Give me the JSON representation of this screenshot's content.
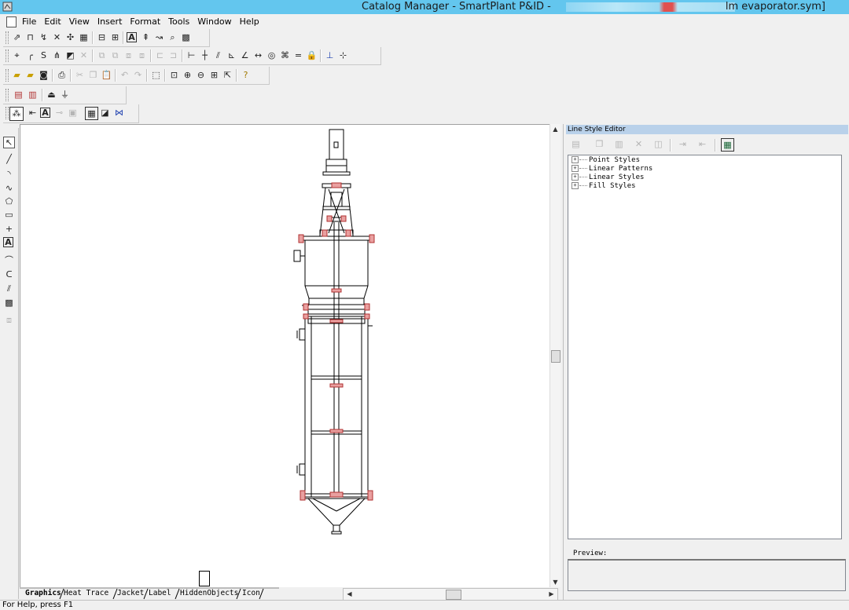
{
  "window": {
    "title": "Catalog Manager - SmartPlant P&ID -",
    "title_suffix": "lm evaporator.sym]"
  },
  "menu": [
    "File",
    "Edit",
    "View",
    "Insert",
    "Format",
    "Tools",
    "Window",
    "Help"
  ],
  "panel": {
    "title": "Line Style Editor",
    "tree": [
      "Point Styles",
      "Linear Patterns",
      "Linear Styles",
      "Fill Styles"
    ],
    "preview_label": "Preview:"
  },
  "tabs": [
    "Graphics",
    "Heat Trace",
    "Jacket",
    "Label",
    "HiddenObjects",
    "Icon"
  ],
  "status": "For Help, press F1"
}
